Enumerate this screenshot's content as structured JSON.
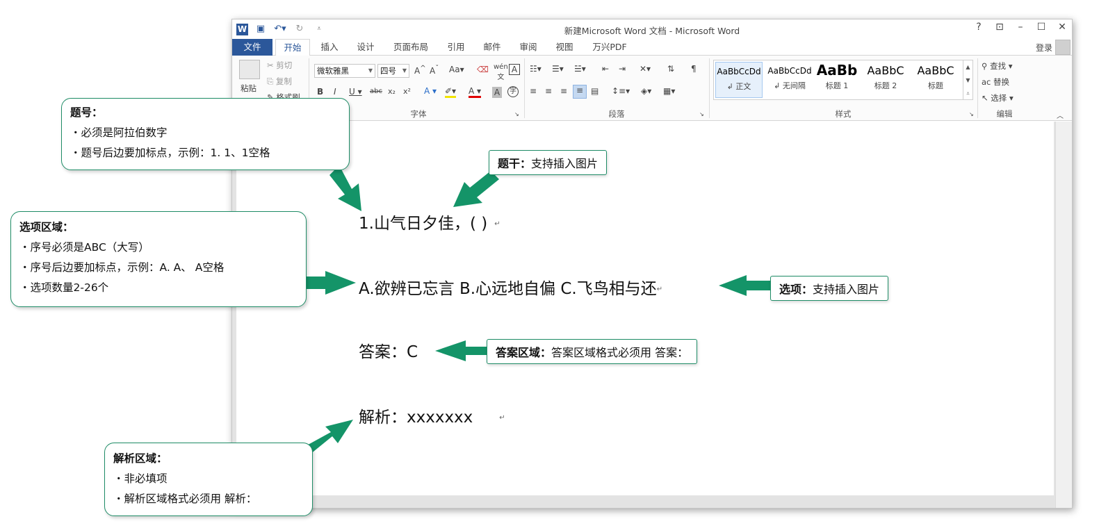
{
  "window": {
    "title": "新建Microsoft Word 文档 - Microsoft Word",
    "login": "登录",
    "controls": [
      "?",
      "⊡",
      "–",
      "☐",
      "✕"
    ]
  },
  "tabs": [
    "文件",
    "开始",
    "插入",
    "设计",
    "页面布局",
    "引用",
    "邮件",
    "审阅",
    "视图",
    "万兴PDF"
  ],
  "ribbon": {
    "clipboard": {
      "paste": "粘贴",
      "cut": "剪切",
      "copy": "复制",
      "format_painter": "格式刷"
    },
    "font": {
      "name": "微软雅黑",
      "size": "四号",
      "group_label": "字体"
    },
    "paragraph": {
      "group_label": "段落"
    },
    "styles": {
      "group_label": "样式",
      "items": [
        {
          "sample": "AaBbCcDd",
          "name": "↲ 正文"
        },
        {
          "sample": "AaBbCcDd",
          "name": "↲ 无间隔"
        },
        {
          "sample": "AaBb",
          "name": "标题 1"
        },
        {
          "sample": "AaBbC",
          "name": "标题 2"
        },
        {
          "sample": "AaBbC",
          "name": "标题"
        }
      ]
    },
    "editing": {
      "find": "查找",
      "replace": "替换",
      "select": "选择",
      "group_label": "编辑"
    }
  },
  "document": {
    "question": "1.山气日夕佳，( )",
    "options": "A.欲辨已忘言 B.心远地自偏 C.飞鸟相与还",
    "answer": "答案：C",
    "analysis": "解析：xxxxxxx",
    "para_mark": "↵"
  },
  "callouts": {
    "number": {
      "title": "题号：",
      "lines": [
        "・必须是阿拉伯数字",
        "・题号后边要加标点，示例：1. 1、1空格"
      ]
    },
    "options": {
      "title": "选项区域：",
      "lines": [
        "・序号必须是ABC（大写）",
        "・序号后边要加标点，示例：A. A、 A空格",
        "・选项数量2-26个"
      ]
    },
    "analysis": {
      "title": "解析区域：",
      "lines": [
        "・非必填项",
        "・解析区域格式必须用 解析："
      ]
    },
    "stem": {
      "bold": "题干：",
      "text": "支持插入图片"
    },
    "option_tag": {
      "bold": "选项：",
      "text": "支持插入图片"
    },
    "answer_tag": {
      "bold": "答案区域：",
      "text": "答案区域格式必须用 答案："
    }
  },
  "colors": {
    "accent_green": "#1e8c66",
    "arrow_green": "#149468",
    "word_blue": "#2b579a"
  }
}
